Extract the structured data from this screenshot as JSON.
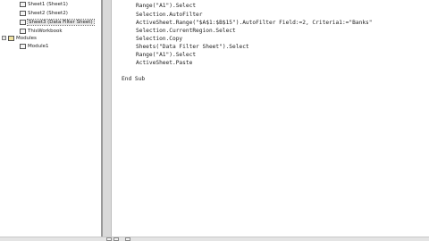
{
  "project_tree": {
    "items": [
      {
        "label": "Sheet1 (Sheet1)"
      },
      {
        "label": "Sheet2 (Sheet2)"
      },
      {
        "label": "Sheet3 (Data Filter Sheet)"
      },
      {
        "label": "ThisWorkbook"
      },
      {
        "label": "Modules"
      },
      {
        "label": "Module1"
      }
    ],
    "modules_toggle": "−"
  },
  "code": {
    "lines": [
      "Range(\"A1\").Select",
      "Selection.AutoFilter",
      "ActiveSheet.Range(\"$A$1:$B$15\").AutoFilter Field:=2, Criteria1:=\"Banks\"",
      "Selection.CurrentRegion.Select",
      "Selection.Copy",
      "Sheets(\"Data Filter Sheet\").Select",
      "Range(\"A1\").Select",
      "ActiveSheet.Paste",
      "End Sub"
    ]
  }
}
